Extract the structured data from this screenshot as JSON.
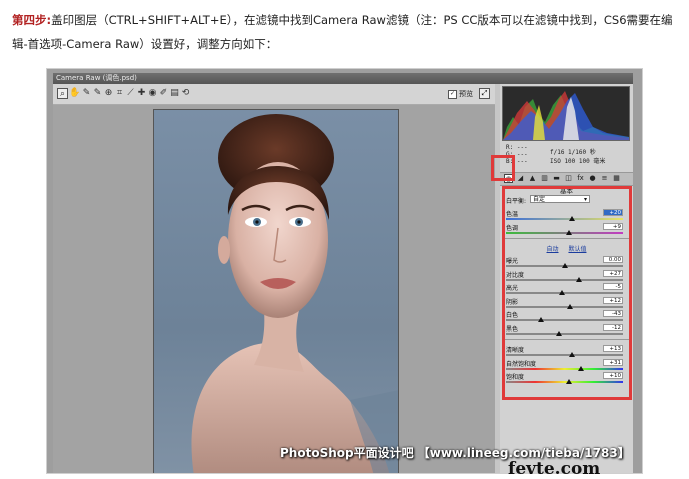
{
  "intro": {
    "step_label": "第四步:",
    "text": "盖印图层（CTRL+SHIFT+ALT+E），在滤镜中找到Camera Raw滤镜（注：PS CC版本可以在滤镜中找到，CS6需要在编辑-首选项-Camera Raw）设置好，调整方向如下："
  },
  "dialog": {
    "title": "Camera Raw (调色.psd)",
    "toolbar_icons": [
      "zoom-icon",
      "hand-icon",
      "white-balance-icon",
      "color-sampler-icon",
      "targeted-adjust-icon",
      "crop-icon",
      "straighten-icon",
      "spot-removal-icon",
      "red-eye-icon",
      "adjustment-brush-icon",
      "graduated-filter-icon",
      "rotate-icon"
    ],
    "preview_label": "预览",
    "readout": {
      "r": "R:  ---",
      "g": "G:  ---",
      "b": "B:  ---",
      "exposure_line": "f/16   1/160 秒",
      "iso_line": "ISO 100  100 毫米"
    },
    "panel_title": "基本",
    "white_balance_label": "白平衡:",
    "white_balance_value": "自定",
    "auto_link": "自动",
    "default_link": "默认值",
    "sliders": [
      {
        "label": "色温",
        "value": "+20",
        "pos": 0.56,
        "track": "temp",
        "selected": true
      },
      {
        "label": "色调",
        "value": "+9",
        "pos": 0.54,
        "track": "tint"
      }
    ],
    "tone_sliders": [
      {
        "label": "曝光",
        "value": "0.00",
        "pos": 0.5
      },
      {
        "label": "对比度",
        "value": "+27",
        "pos": 0.62
      },
      {
        "label": "高光",
        "value": "-5",
        "pos": 0.48
      },
      {
        "label": "阴影",
        "value": "+12",
        "pos": 0.55
      },
      {
        "label": "白色",
        "value": "-43",
        "pos": 0.3
      },
      {
        "label": "黑色",
        "value": "-12",
        "pos": 0.45
      }
    ],
    "presence_sliders": [
      {
        "label": "清晰度",
        "value": "+13",
        "pos": 0.56,
        "track": "plain"
      },
      {
        "label": "自然饱和度",
        "value": "+31",
        "pos": 0.64,
        "track": "sat"
      },
      {
        "label": "饱和度",
        "value": "+10",
        "pos": 0.54,
        "track": "sat"
      }
    ]
  },
  "watermark": "PhotoShop平面设计吧 【www.lineeg.com/tieba/1783】",
  "brand": "fevte.com",
  "colors": {
    "highlight": "#e03a3a",
    "step_label": "#b22222"
  }
}
